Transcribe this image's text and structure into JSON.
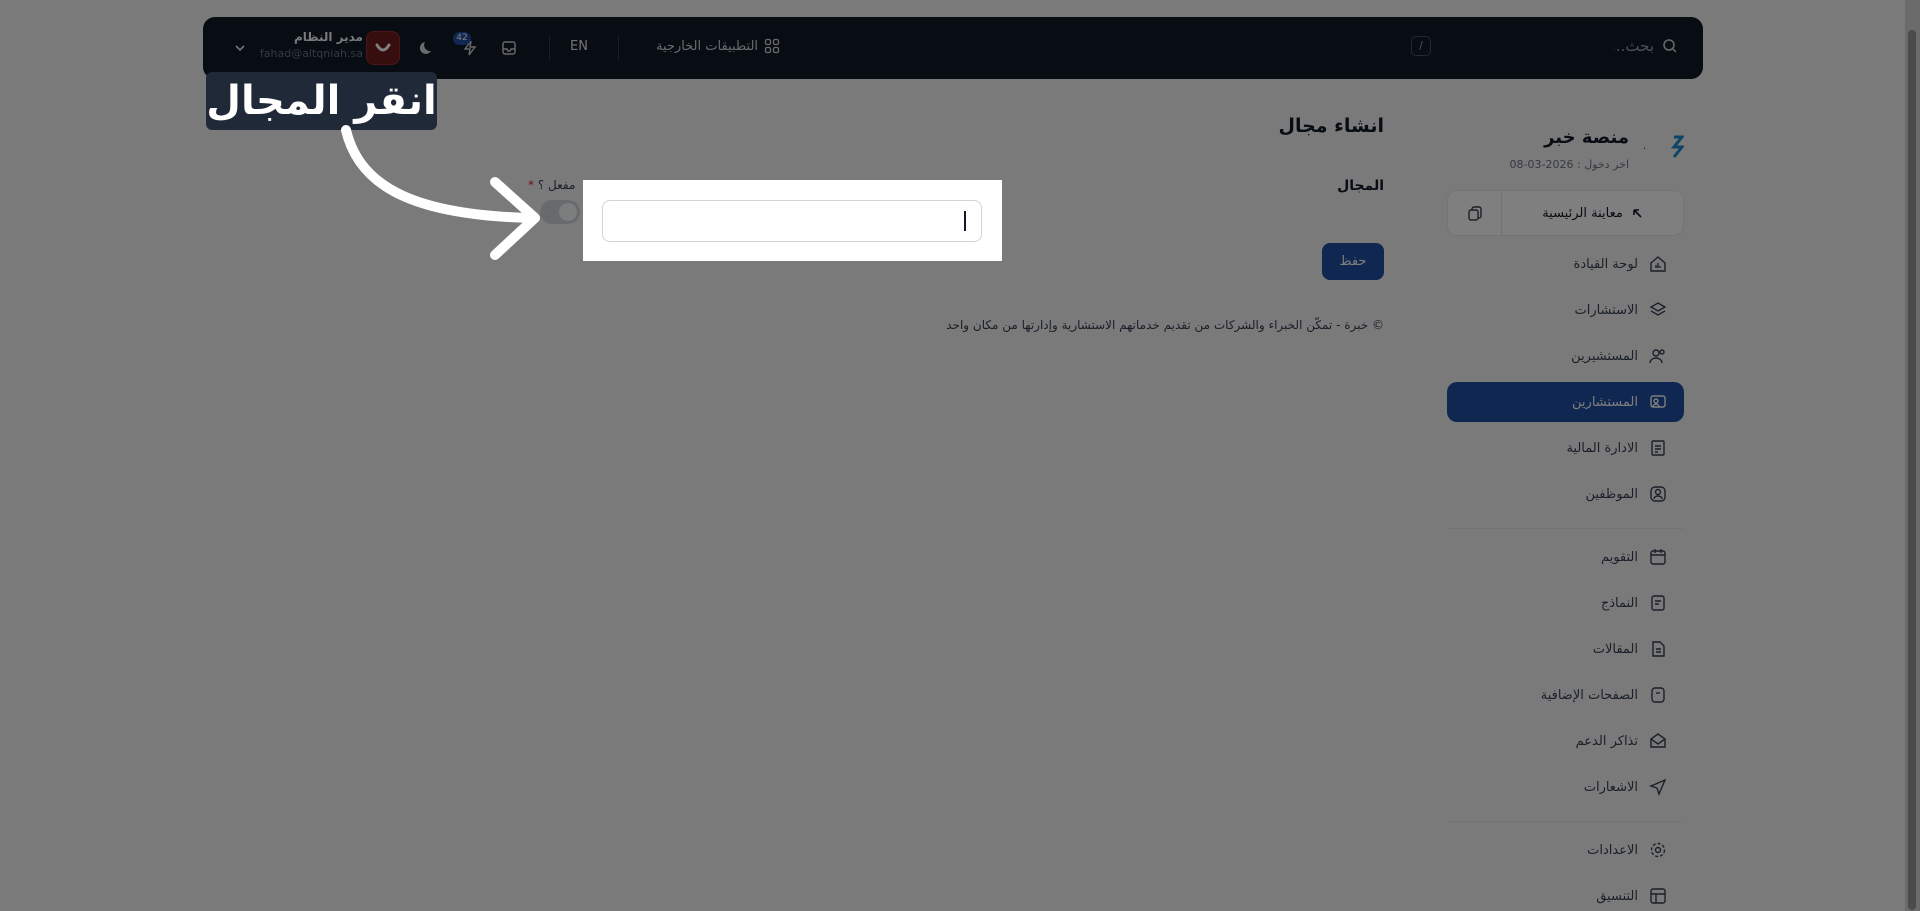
{
  "topbar": {
    "search_placeholder": "بحث...",
    "search_shortcut": "/",
    "external_apps_label": "التطبيقات الخارجية",
    "language_label": "EN",
    "notifications_count": "42",
    "user_name": "مدير النظام",
    "user_email": "fahad@altqniah.sa"
  },
  "sidebar": {
    "brand_name": "منصة خبر",
    "last_login": "اخر دخول : 2026-03-08",
    "preview_label": "معاينة الرئيسية",
    "items": [
      {
        "label": "لوحة القيادة",
        "icon": "home-chart-icon",
        "active": false
      },
      {
        "label": "الاستشارات",
        "icon": "layers-icon",
        "active": false
      },
      {
        "label": "المستشيرين",
        "icon": "users-icon",
        "active": false
      },
      {
        "label": "المستشارين",
        "icon": "consultant-icon",
        "active": true
      },
      {
        "label": "الادارة المالية",
        "icon": "receipt-icon",
        "active": false
      },
      {
        "label": "الموظفين",
        "icon": "employee-icon",
        "active": false
      }
    ],
    "items2": [
      {
        "label": "التقويم",
        "icon": "calendar-icon"
      },
      {
        "label": "النماذج",
        "icon": "form-icon"
      },
      {
        "label": "المقالات",
        "icon": "articles-icon"
      },
      {
        "label": "الصفحات الإضافية",
        "icon": "pages-icon"
      },
      {
        "label": "تذاكر الدعم",
        "icon": "ticket-icon"
      },
      {
        "label": "الاشعارات",
        "icon": "send-icon"
      }
    ],
    "items3": [
      {
        "label": "الاعدادات",
        "icon": "gear-icon"
      },
      {
        "label": "التنسيق",
        "icon": "layout-icon"
      }
    ]
  },
  "main": {
    "page_title": "انشاء مجال",
    "field_label": "المجال",
    "field_value": "",
    "enabled_label": "مفعل ؟",
    "required_mark": "*",
    "save_label": "حفظ",
    "footer": "© خبرة - تمكّن الخبراء والشركات من تقديم خدماتهم الاستشارية وإدارتها من مكان واحد"
  },
  "callout": {
    "text": "انقر المجال"
  },
  "colors": {
    "accent": "#1e4fa3",
    "topbar_bg": "#111827",
    "page_bg": "#f4f5f7"
  }
}
